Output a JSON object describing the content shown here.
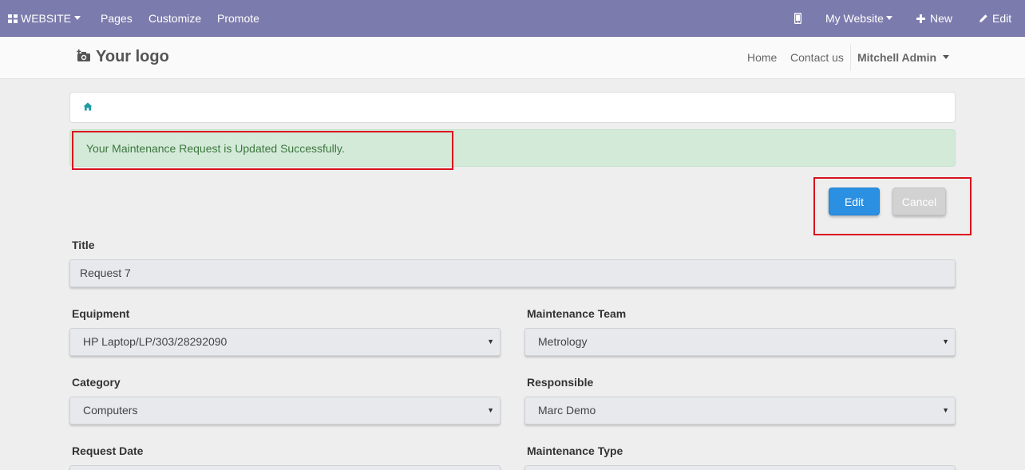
{
  "topbar": {
    "website_label": "WEBSITE",
    "pages_label": "Pages",
    "customize_label": "Customize",
    "promote_label": "Promote",
    "my_website_label": "My Website",
    "new_label": "New",
    "edit_label": "Edit",
    "color": "#7c7bad"
  },
  "header": {
    "logo_text": "Your logo",
    "nav": {
      "home": "Home",
      "contact": "Contact us",
      "user": "Mitchell Admin"
    }
  },
  "alert": {
    "message": "Your Maintenance Request is Updated Successfully."
  },
  "actions": {
    "edit_label": "Edit",
    "cancel_label": "Cancel"
  },
  "form": {
    "title_label": "Title",
    "title_value": "Request 7",
    "equipment_label": "Equipment",
    "equipment_value": "HP Laptop/LP/303/28292090",
    "team_label": "Maintenance Team",
    "team_value": "Metrology",
    "category_label": "Category",
    "category_value": "Computers",
    "responsible_label": "Responsible",
    "responsible_value": "Marc Demo",
    "request_date_label": "Request Date",
    "maintenance_type_label": "Maintenance Type"
  }
}
